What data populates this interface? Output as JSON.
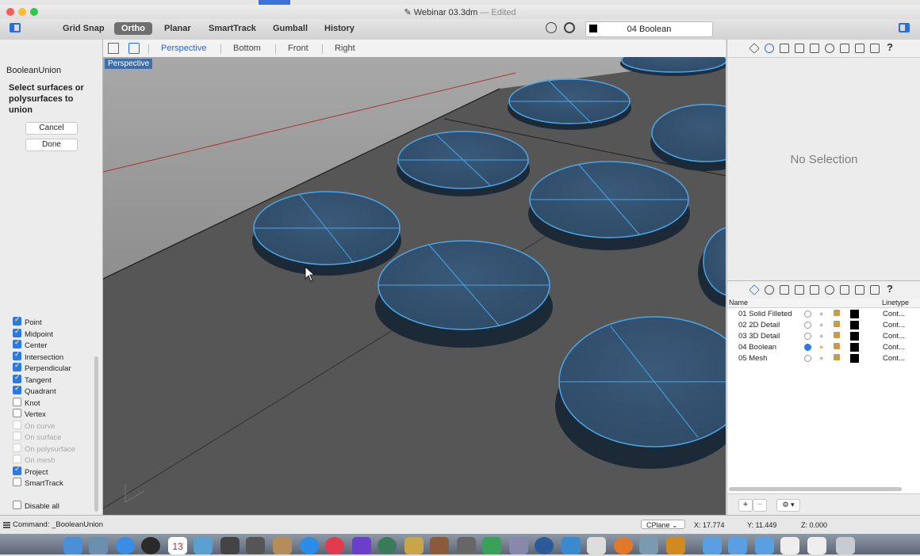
{
  "window": {
    "title": "Webinar 03.3dm",
    "separator": "—",
    "status": "Edited"
  },
  "toolbar": {
    "buttons": [
      {
        "label": "Grid Snap",
        "active": false
      },
      {
        "label": "Ortho",
        "active": true
      },
      {
        "label": "Planar",
        "active": false
      },
      {
        "label": "SmartTrack",
        "active": false
      },
      {
        "label": "Gumball",
        "active": false
      },
      {
        "label": "History",
        "active": false
      }
    ],
    "current_layer": "04 Boolean"
  },
  "command_panel": {
    "title": "BooleanUnion",
    "prompt": "Select surfaces or polysurfaces to union",
    "cancel_label": "Cancel",
    "done_label": "Done"
  },
  "osnaps": [
    {
      "label": "Point",
      "checked": true,
      "disabled": false
    },
    {
      "label": "Midpoint",
      "checked": true,
      "disabled": false
    },
    {
      "label": "Center",
      "checked": true,
      "disabled": false
    },
    {
      "label": "Intersection",
      "checked": true,
      "disabled": false
    },
    {
      "label": "Perpendicular",
      "checked": true,
      "disabled": false
    },
    {
      "label": "Tangent",
      "checked": true,
      "disabled": false
    },
    {
      "label": "Quadrant",
      "checked": true,
      "disabled": false
    },
    {
      "label": "Knot",
      "checked": false,
      "disabled": false
    },
    {
      "label": "Vertex",
      "checked": false,
      "disabled": false
    },
    {
      "label": "On curve",
      "checked": false,
      "disabled": true
    },
    {
      "label": "On surface",
      "checked": false,
      "disabled": true
    },
    {
      "label": "On polysurface",
      "checked": false,
      "disabled": true
    },
    {
      "label": "On mesh",
      "checked": false,
      "disabled": true
    },
    {
      "label": "Project",
      "checked": true,
      "disabled": false
    },
    {
      "label": "SmartTrack",
      "checked": false,
      "disabled": false
    },
    {
      "label": "Disable all",
      "checked": false,
      "disabled": false
    }
  ],
  "viewport_tabs": [
    {
      "label": "Perspective",
      "active": true
    },
    {
      "label": "Bottom",
      "active": false
    },
    {
      "label": "Front",
      "active": false
    },
    {
      "label": "Right",
      "active": false
    }
  ],
  "viewport": {
    "label": "Perspective"
  },
  "properties": {
    "empty_text": "No Selection"
  },
  "layers": {
    "headers": {
      "name": "Name",
      "linetype": "Linetype"
    },
    "rows": [
      {
        "name": "01 Solid Filleted",
        "current": false,
        "on": false,
        "linetype": "Cont..."
      },
      {
        "name": "02 2D Detail",
        "current": false,
        "on": false,
        "linetype": "Cont..."
      },
      {
        "name": "03 3D Detail",
        "current": false,
        "on": false,
        "linetype": "Cont..."
      },
      {
        "name": "04 Boolean",
        "current": true,
        "on": true,
        "linetype": "Cont..."
      },
      {
        "name": "05 Mesh",
        "current": false,
        "on": false,
        "linetype": "Cont..."
      }
    ],
    "add_label": "+",
    "remove_label": "−",
    "gear_label": "⚙ ▾"
  },
  "status": {
    "command": "Command: _BooleanUnion",
    "cplane": "CPlane",
    "x": "X: 17.774",
    "y": "Y: 11.449",
    "z": "Z: 0.000"
  },
  "dock": {
    "calendar_day": "13"
  },
  "colors": {
    "accent": "#2b6ed6",
    "selection_blue": "#4aa6e8",
    "viewport_bg": "#575757"
  }
}
